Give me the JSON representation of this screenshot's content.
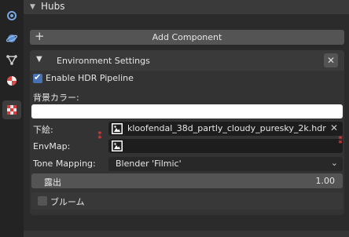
{
  "sidebar": {
    "icons": [
      "scene-icon",
      "world-icon",
      "modifier-icon",
      "material-icon",
      "texture-icon"
    ],
    "active_index": 4
  },
  "hubs": {
    "title": "Hubs"
  },
  "add_component": {
    "label": "Add Component"
  },
  "environment": {
    "title": "Environment Settings",
    "close_label": "✕",
    "hdr_pipeline": {
      "label": "Enable HDR Pipeline",
      "checked": true
    },
    "background_color_label": "背景カラー:",
    "background_color": "#ffffff",
    "background_image": {
      "label": "下絵:",
      "file_name": "kloofendal_38d_partly_cloudy_puresky_2k.hdr",
      "clear_label": "✕"
    },
    "envmap": {
      "label": "EnvMap:",
      "file_name": ""
    },
    "tone_mapping": {
      "label": "Tone Mapping:",
      "value": "Blender 'Filmic'"
    },
    "exposure": {
      "label": "露出",
      "value": "1.00"
    },
    "bloom": {
      "label": "ブルーム",
      "checked": false
    }
  },
  "colors": {
    "accent": "#4772b3",
    "annotation": "#e03b3b"
  }
}
